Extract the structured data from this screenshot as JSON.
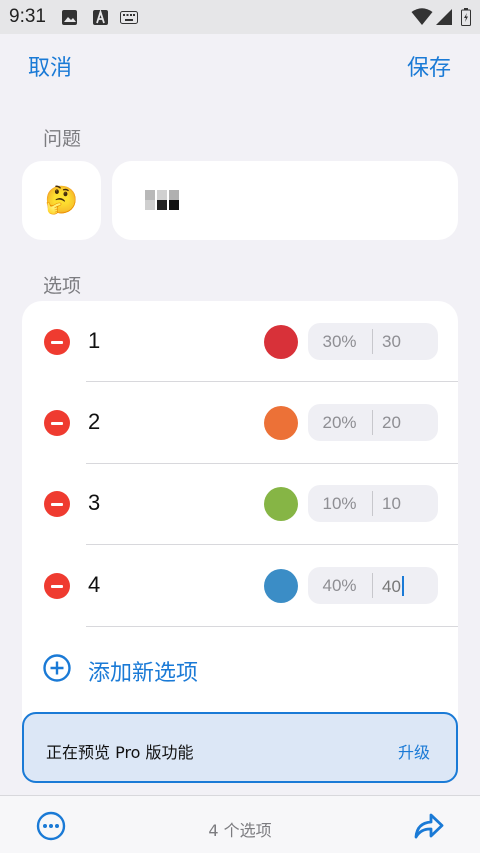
{
  "status_bar": {
    "time": "9:31"
  },
  "header": {
    "cancel_label": "取消",
    "save_label": "保存"
  },
  "question": {
    "section_label": "问题",
    "emoji": "🤔"
  },
  "options": {
    "section_label": "选项",
    "items": [
      {
        "label": "1",
        "color": "#d83139",
        "percent": "30%",
        "value": "30"
      },
      {
        "label": "2",
        "color": "#ec7137",
        "percent": "20%",
        "value": "20"
      },
      {
        "label": "3",
        "color": "#86b545",
        "percent": "10%",
        "value": "10"
      },
      {
        "label": "4",
        "color": "#3b8dc6",
        "percent": "40%",
        "value": "40"
      }
    ],
    "add_label": "添加新选项"
  },
  "pro_banner": {
    "text": "正在预览 Pro 版功能",
    "upgrade_label": "升级"
  },
  "bottom_bar": {
    "count_label": "4 个选项"
  },
  "colors": {
    "accent": "#1a7ad6",
    "destructive": "#ef3b30"
  }
}
